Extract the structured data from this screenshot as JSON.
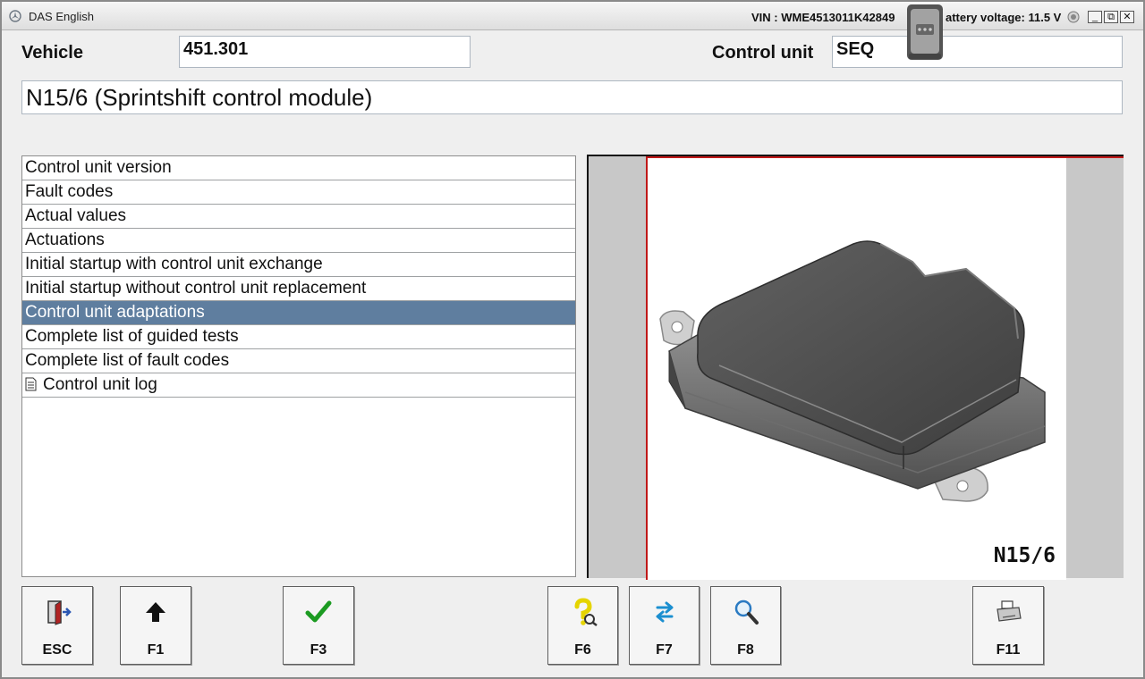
{
  "window": {
    "title": "DAS English",
    "vin_text": "VIN : WME4513011K42849",
    "battery_text": "attery voltage: 11.5 V",
    "controls": [
      "_",
      "⧉",
      "✕"
    ]
  },
  "header": {
    "vehicle_label": "Vehicle",
    "vehicle_value": "451.301",
    "control_unit_label": "Control unit",
    "control_unit_value": "SEQ",
    "module_title": "N15/6 (Sprintshift control module)"
  },
  "menu": {
    "items": [
      {
        "label": "Control unit version"
      },
      {
        "label": "Fault codes"
      },
      {
        "label": "Actual values"
      },
      {
        "label": "Actuations"
      },
      {
        "label": "Initial startup with control unit exchange"
      },
      {
        "label": "Initial startup without control unit replacement"
      },
      {
        "label": "Control unit adaptations",
        "selected": true
      },
      {
        "label": "Complete list of guided tests"
      },
      {
        "label": "Complete list of fault codes"
      },
      {
        "label": "Control unit log",
        "icon": "document-icon"
      }
    ]
  },
  "image": {
    "label": "N15/6"
  },
  "function_keys": [
    {
      "label": "ESC",
      "icon": "exit-door-icon"
    },
    {
      "label": "F1",
      "icon": "arrow-up-icon"
    },
    {
      "label": "F3",
      "icon": "checkmark-icon"
    },
    {
      "label": "F6",
      "icon": "help-question-icon"
    },
    {
      "label": "F7",
      "icon": "swap-arrows-icon"
    },
    {
      "label": "F8",
      "icon": "magnifier-icon"
    },
    {
      "label": "F11",
      "icon": "printer-icon"
    }
  ],
  "colors": {
    "selected_row": "#5f7e9f",
    "image_border_red": "#c01818",
    "checkmark_green": "#1c9b22",
    "help_yellow": "#e5d400",
    "swap_blue": "#1b8fd0"
  }
}
